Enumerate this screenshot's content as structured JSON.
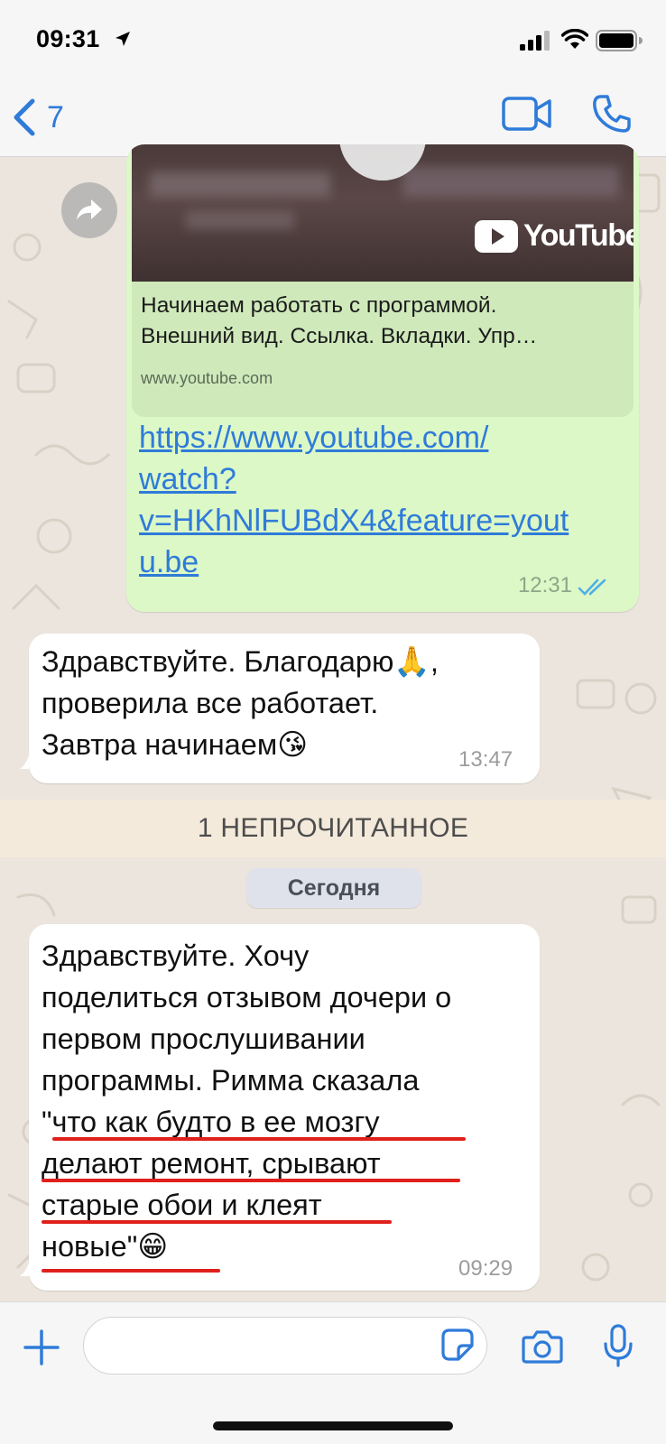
{
  "status_bar": {
    "time": "09:31"
  },
  "header": {
    "back_count": "7"
  },
  "messages": {
    "outgoing_link": {
      "preview_title_lines": [
        "Начинаем работать с программой.",
        "Внешний вид. Ссылка. Вкладки. Упр…"
      ],
      "preview_domain": "www.youtube.com",
      "youtube_logo_text": "YouTube",
      "link_lines": [
        "https://www.youtube.com/",
        "watch?",
        "v=HKhNlFUBdX4&feature=yout",
        "u.be"
      ],
      "time": "12:31"
    },
    "incoming_1": {
      "lines": [
        "Здравствуйте. Благодарю🙏,",
        "проверила все работает.",
        "Завтра начинаем😘"
      ],
      "time": "13:47"
    },
    "unread_banner": "1 НЕПРОЧИТАННОЕ",
    "date_divider": "Сегодня",
    "incoming_2": {
      "lines": [
        "Здравствуйте. Хочу",
        "поделиться отзывом дочери о",
        "первом  прослушивании",
        "программы. Римма сказала",
        "\"что как будто в ее мозгу",
        "делают ремонт, срывают",
        "старые обои и клеят",
        "новые\"😁"
      ],
      "time": "09:29"
    }
  },
  "composer": {
    "placeholder": ""
  },
  "colors": {
    "accent": "#2f7bd9",
    "outgoing_bubble": "#dcf8c6",
    "incoming_bubble": "#ffffff",
    "underline_annotation": "#e0201c"
  }
}
